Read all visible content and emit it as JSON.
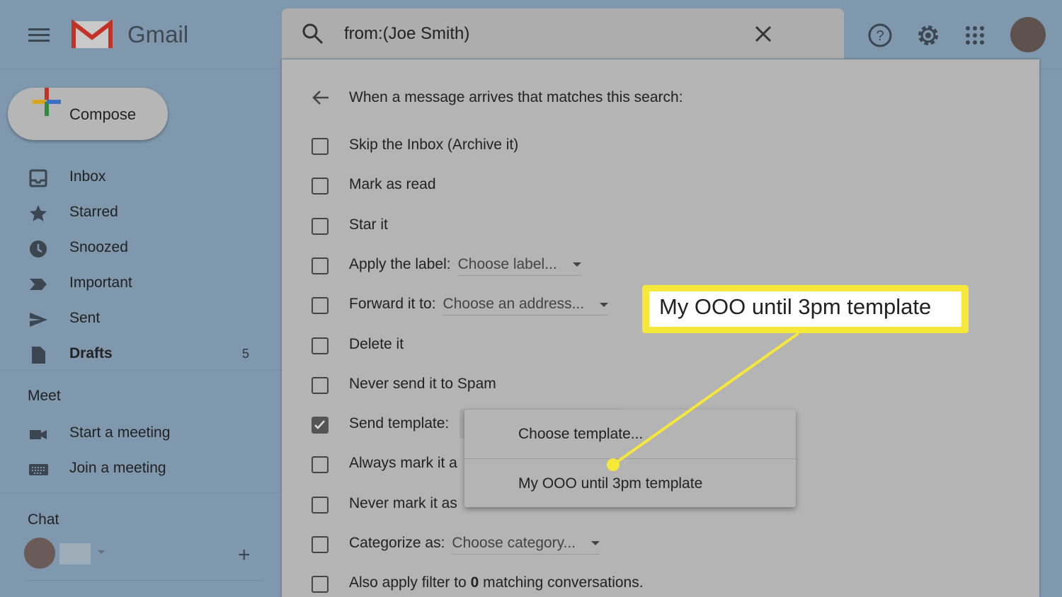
{
  "app": {
    "brand": "Gmail"
  },
  "compose": {
    "label": "Compose"
  },
  "sidebar": {
    "items": [
      {
        "label": "Inbox",
        "icon": "inbox-icon"
      },
      {
        "label": "Starred",
        "icon": "star-icon"
      },
      {
        "label": "Snoozed",
        "icon": "clock-icon"
      },
      {
        "label": "Important",
        "icon": "important-icon"
      },
      {
        "label": "Sent",
        "icon": "send-icon"
      },
      {
        "label": "Drafts",
        "icon": "draft-icon",
        "count": "5"
      }
    ],
    "meet": {
      "title": "Meet",
      "items": [
        {
          "label": "Start a meeting"
        },
        {
          "label": "Join a meeting"
        }
      ]
    },
    "chat": {
      "title": "Chat"
    }
  },
  "search": {
    "query": "from:(Joe Smith)"
  },
  "filter": {
    "header": "When a message arrives that matches this search:",
    "options": [
      {
        "label": "Skip the Inbox (Archive it)",
        "checked": false
      },
      {
        "label": "Mark as read",
        "checked": false
      },
      {
        "label": "Star it",
        "checked": false
      },
      {
        "label": "Apply the label:",
        "select": "Choose label...",
        "checked": false
      },
      {
        "label": "Forward it to:",
        "select": "Choose an address...",
        "checked": false
      },
      {
        "label": "Delete it",
        "checked": false
      },
      {
        "label": "Never send it to Spam",
        "checked": false
      },
      {
        "label": "Send template:",
        "checked": true
      },
      {
        "label": "Always mark it a",
        "checked": false
      },
      {
        "label": "Never mark it as",
        "checked": false
      },
      {
        "label": "Categorize as:",
        "select": "Choose category...",
        "checked": false
      },
      {
        "label_pre": "Also apply filter to ",
        "count": "0",
        "label_post": " matching conversations.",
        "checked": false
      }
    ]
  },
  "template_menu": {
    "options": [
      "Choose template...",
      "My OOO until 3pm template"
    ]
  },
  "callout": {
    "text": "My OOO until 3pm template",
    "color": "#f5e83a"
  }
}
